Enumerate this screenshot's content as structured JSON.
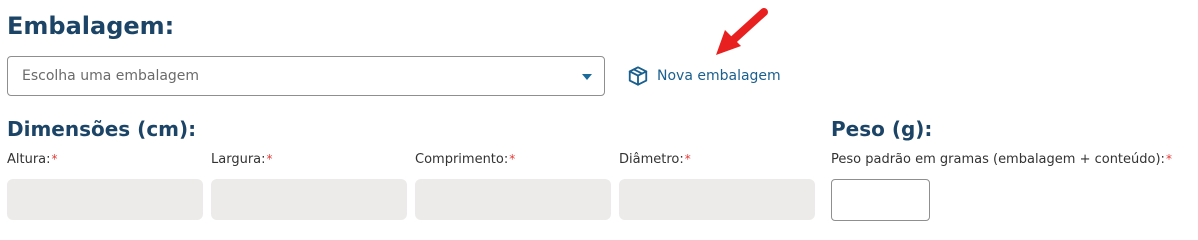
{
  "packaging": {
    "title": "Embalagem:",
    "select_placeholder": "Escolha uma embalagem",
    "new_label": "Nova embalagem"
  },
  "dimensions": {
    "title": "Dimensões (cm):",
    "fields": [
      {
        "label": "Altura:"
      },
      {
        "label": "Largura:"
      },
      {
        "label": "Comprimento:"
      },
      {
        "label": "Diâmetro:"
      }
    ],
    "required_mark": "*"
  },
  "weight": {
    "title": "Peso (g):",
    "label": "Peso padrão em gramas (embalagem + conteúdo):",
    "required_mark": "*"
  },
  "colors": {
    "heading": "#1b4466",
    "link": "#1a5f8e",
    "required": "#e53935",
    "disabled_input": "#ecebe9",
    "arrow": "#e8201f"
  }
}
